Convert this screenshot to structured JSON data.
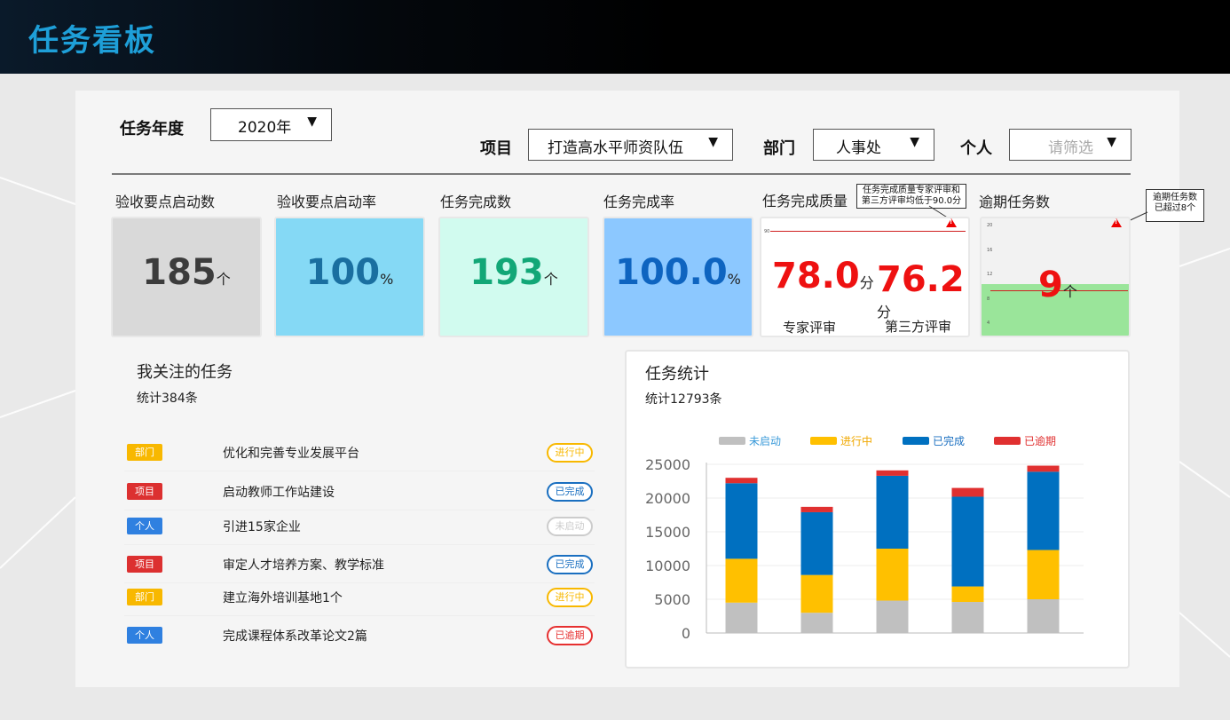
{
  "header": {
    "title": "任务看板"
  },
  "filters": {
    "year_label": "任务年度",
    "year_value": "2020年",
    "project_label": "项目",
    "project_value": "打造高水平师资队伍",
    "dept_label": "部门",
    "dept_value": "人事处",
    "person_label": "个人",
    "person_placeholder": "请筛选"
  },
  "kpis": [
    {
      "title": "验收要点启动数",
      "value": "185",
      "unit": "个",
      "bg": "#d9d9d9",
      "color": "#3c3c3c"
    },
    {
      "title": "验收要点启动率",
      "value": "100",
      "unit": "%",
      "bg": "#85d9f5",
      "color": "#1a6fa0"
    },
    {
      "title": "任务完成数",
      "value": "193",
      "unit": "个",
      "bg": "#d1fbef",
      "color": "#12a777"
    },
    {
      "title": "任务完成率",
      "value": "100.0",
      "unit": "%",
      "bg": "#8cc8ff",
      "color": "#0e64c0"
    }
  ],
  "quality": {
    "title": "任务完成质量",
    "tooltip": [
      "任务完成质量专家评审和",
      "第三方评审均低于90.0分"
    ],
    "threshold_tick": "90",
    "expert_value": "78.0",
    "expert_unit": "分",
    "expert_label": "专家评审",
    "third_value": "76.2",
    "third_unit": "分",
    "third_label": "第三方评审"
  },
  "overdue": {
    "title": "逾期任务数",
    "tooltip": [
      "逾期任务数",
      "已超过8个"
    ],
    "value": "9",
    "unit": "个",
    "ticks": [
      "20",
      "16",
      "12",
      "8",
      "4",
      "0"
    ]
  },
  "followed": {
    "title": "我关注的任务",
    "count": "统计384条",
    "items": [
      {
        "tag": "部门",
        "tag_color": "#f8b800",
        "text": "优化和完善专业发展平台",
        "status": "进行中",
        "status_color": "#f8b800"
      },
      {
        "tag": "项目",
        "tag_color": "#dc3030",
        "text": "启动教师工作站建设",
        "status": "已完成",
        "status_color": "#1a6fc0"
      },
      {
        "tag": "个人",
        "tag_color": "#2f80e0",
        "text": "引进15家企业",
        "status": "未启动",
        "status_color": "#cccccc"
      },
      {
        "tag": "项目",
        "tag_color": "#dc3030",
        "text": "审定人才培养方案、教学标准",
        "status": "已完成",
        "status_color": "#1a6fc0"
      },
      {
        "tag": "部门",
        "tag_color": "#f8b800",
        "text": "建立海外培训基地1个",
        "status": "进行中",
        "status_color": "#f8b800"
      },
      {
        "tag": "个人",
        "tag_color": "#2f80e0",
        "text": "完成课程体系改革论文2篇",
        "status": "已逾期",
        "status_color": "#e63030"
      }
    ]
  },
  "stats": {
    "title": "任务统计",
    "count": "统计12793条"
  },
  "chart_data": {
    "type": "bar",
    "stacked": true,
    "categories": [
      "",
      "",
      "",
      "",
      ""
    ],
    "series": [
      {
        "name": "未启动",
        "color": "#c0c0c0",
        "values": [
          4500,
          3000,
          4800,
          4600,
          5000
        ]
      },
      {
        "name": "进行中",
        "color": "#ffc000",
        "values": [
          6500,
          5600,
          7700,
          2300,
          7300
        ]
      },
      {
        "name": "已完成",
        "color": "#0070c0",
        "values": [
          11200,
          9300,
          10800,
          13300,
          11600
        ]
      },
      {
        "name": "已逾期",
        "color": "#e03030",
        "values": [
          800,
          800,
          800,
          1300,
          900
        ]
      }
    ],
    "ylim": [
      0,
      25000
    ],
    "yticks": [
      "25000",
      "20000",
      "15000",
      "10000",
      "5000",
      "0"
    ],
    "legend_text_colors": [
      "#3a9ad9",
      "#f0a800",
      "#1a6fc0",
      "#e03030"
    ]
  }
}
